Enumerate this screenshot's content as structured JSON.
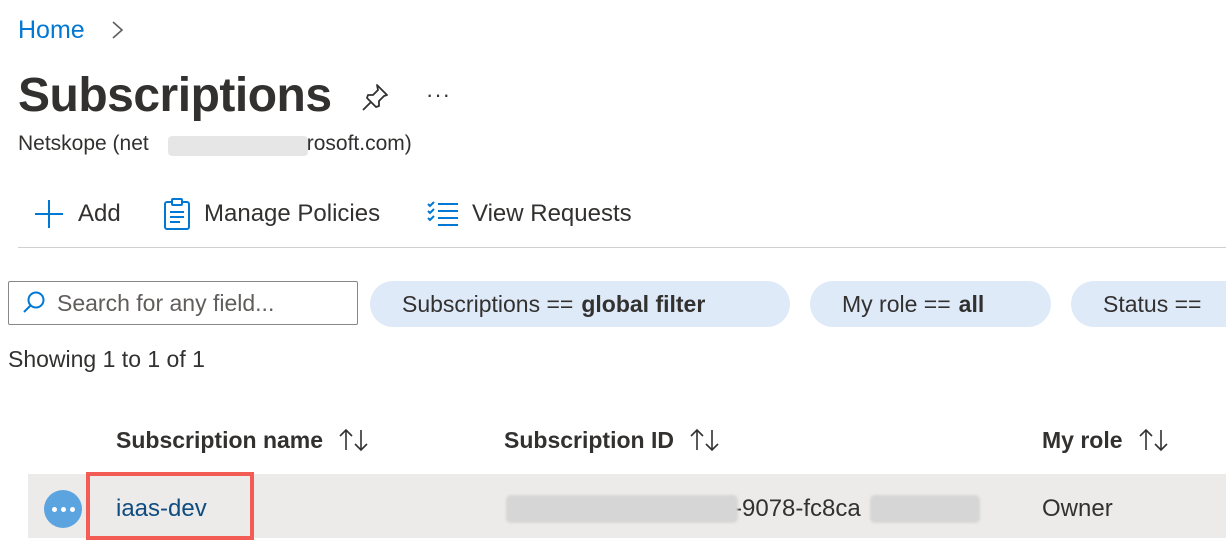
{
  "breadcrumb": {
    "home": "Home"
  },
  "header": {
    "title": "Subscriptions",
    "more": "···",
    "subtitle": "Netskope (net",
    "subtitle_tail": "rosoft.com)"
  },
  "toolbar": {
    "add": "Add",
    "manage_policies": "Manage Policies",
    "view_requests": "View Requests"
  },
  "filters": {
    "search_placeholder": "Search for any field...",
    "pills": [
      {
        "key": "Subscriptions ==",
        "value": "global filter"
      },
      {
        "key": "My role ==",
        "value": "all"
      },
      {
        "key": "Status ==",
        "value": ""
      }
    ]
  },
  "results": {
    "showing": "Showing 1 to 1 of 1"
  },
  "table": {
    "columns": [
      "Subscription name",
      "Subscription ID",
      "My role"
    ],
    "rows": [
      {
        "name": "iaas-dev",
        "id_visible": "-9078-fc8ca",
        "role": "Owner"
      }
    ]
  },
  "colors": {
    "accent": "#0078d4",
    "pill_bg": "#dfeaf8",
    "highlight": "#f25c54",
    "row_bg": "#edebe9"
  }
}
